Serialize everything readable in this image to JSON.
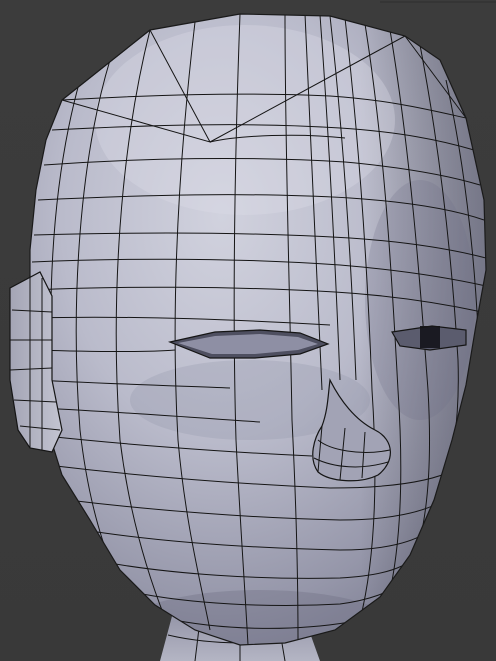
{
  "viewport": {
    "object": "head-mesh",
    "view_mode": "solid",
    "show_wireframe": true
  },
  "colors": {
    "background": "#3a3a3a",
    "mesh_light": "#c9cad6",
    "mesh_mid": "#a9aab9",
    "mesh_shadow": "#7d7e92",
    "wire": "#151515",
    "cavity": "#4a4b5a"
  }
}
